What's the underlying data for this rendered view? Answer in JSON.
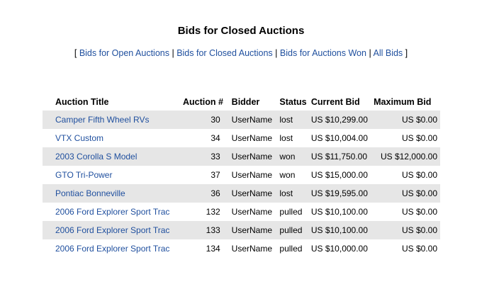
{
  "page": {
    "title": "Bids for Closed Auctions"
  },
  "nav": {
    "open_bracket": "[",
    "close_bracket": "]",
    "separator": "|",
    "links": [
      "Bids for Open Auctions",
      "Bids for Closed Auctions",
      "Bids for Auctions Won",
      "All Bids"
    ]
  },
  "table": {
    "headers": [
      "Auction Title",
      "Auction #",
      "Bidder",
      "Status",
      "Current Bid",
      "Maximum Bid"
    ],
    "rows": [
      {
        "title": "Camper Fifth Wheel RVs",
        "number": "30",
        "bidder": "UserName",
        "status": "lost",
        "current": "US $10,299.00",
        "max": "US $0.00"
      },
      {
        "title": "VTX Custom",
        "number": "34",
        "bidder": "UserName",
        "status": "lost",
        "current": "US $10,004.00",
        "max": "US $0.00"
      },
      {
        "title": "2003 Corolla S Model",
        "number": "33",
        "bidder": "UserName",
        "status": "won",
        "current": "US $11,750.00",
        "max": "US $12,000.00"
      },
      {
        "title": "GTO Tri-Power",
        "number": "37",
        "bidder": "UserName",
        "status": "won",
        "current": "US $15,000.00",
        "max": "US $0.00"
      },
      {
        "title": "Pontiac Bonneville",
        "number": "36",
        "bidder": "UserName",
        "status": "lost",
        "current": "US $19,595.00",
        "max": "US $0.00"
      },
      {
        "title": "2006 Ford Explorer Sport Trac",
        "number": "132",
        "bidder": "UserName",
        "status": "pulled",
        "current": "US $10,100.00",
        "max": "US $0.00"
      },
      {
        "title": "2006 Ford Explorer Sport Trac",
        "number": "133",
        "bidder": "UserName",
        "status": "pulled",
        "current": "US $10,100.00",
        "max": "US $0.00"
      },
      {
        "title": "2006 Ford Explorer Sport Trac",
        "number": "134",
        "bidder": "UserName",
        "status": "pulled",
        "current": "US $10,000.00",
        "max": "US $0.00"
      }
    ]
  },
  "colors": {
    "link": "#1f4f9e",
    "row_alt": "#e6e6e6"
  }
}
